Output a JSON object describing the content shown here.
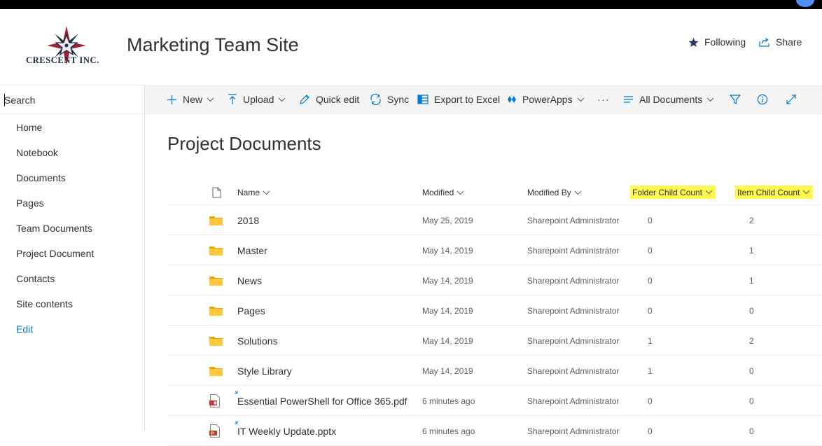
{
  "header": {
    "logo_text": "Crescent Inc.",
    "site_title": "Marketing Team Site",
    "following_label": "Following",
    "share_label": "Share"
  },
  "leftnav": {
    "search_placeholder": "Search",
    "items": [
      {
        "label": "Home"
      },
      {
        "label": "Notebook"
      },
      {
        "label": "Documents"
      },
      {
        "label": "Pages"
      },
      {
        "label": "Team Documents"
      },
      {
        "label": "Project Document"
      },
      {
        "label": "Contacts"
      },
      {
        "label": "Site contents"
      }
    ],
    "edit_label": "Edit"
  },
  "commandbar": {
    "new_label": "New",
    "upload_label": "Upload",
    "quickedit_label": "Quick edit",
    "sync_label": "Sync",
    "export_label": "Export to Excel",
    "powerapps_label": "PowerApps",
    "more_label": "···",
    "view_label": "All Documents"
  },
  "library": {
    "title": "Project Documents",
    "columns": {
      "name": "Name",
      "modified": "Modified",
      "modified_by": "Modified By",
      "folder_child_count": "Folder Child Count",
      "item_child_count": "Item Child Count"
    },
    "rows": [
      {
        "type": "folder",
        "name": "2018",
        "modified": "May 25, 2019",
        "modified_by": "Sharepoint Administrator",
        "folder_count": "0",
        "item_count": "2"
      },
      {
        "type": "folder",
        "name": "Master",
        "modified": "May 14, 2019",
        "modified_by": "Sharepoint Administrator",
        "folder_count": "0",
        "item_count": "1"
      },
      {
        "type": "folder",
        "name": "News",
        "modified": "May 14, 2019",
        "modified_by": "Sharepoint Administrator",
        "folder_count": "0",
        "item_count": "1"
      },
      {
        "type": "folder",
        "name": "Pages",
        "modified": "May 14, 2019",
        "modified_by": "Sharepoint Administrator",
        "folder_count": "0",
        "item_count": "0"
      },
      {
        "type": "folder",
        "name": "Solutions",
        "modified": "May 14, 2019",
        "modified_by": "Sharepoint Administrator",
        "folder_count": "1",
        "item_count": "2"
      },
      {
        "type": "folder",
        "name": "Style Library",
        "modified": "May 14, 2019",
        "modified_by": "Sharepoint Administrator",
        "folder_count": "1",
        "item_count": "0"
      },
      {
        "type": "pdf",
        "name": "Essential PowerShell for Office 365.pdf",
        "modified": "6 minutes ago",
        "modified_by": "Sharepoint Administrator",
        "folder_count": "0",
        "item_count": "0"
      },
      {
        "type": "pptx",
        "name": "IT Weekly Update.pptx",
        "modified": "6 minutes ago",
        "modified_by": "Sharepoint Administrator",
        "folder_count": "0",
        "item_count": "0"
      }
    ]
  },
  "colors": {
    "accent": "#0078d4",
    "folder": "#ffb900",
    "highlight": "#fff94d"
  }
}
